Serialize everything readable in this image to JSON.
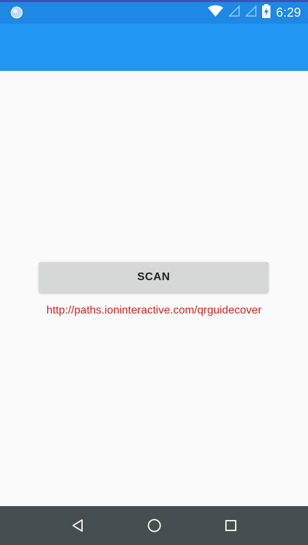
{
  "status_bar": {
    "time": "6:29",
    "background": "#1e88e5",
    "icons": [
      "assistant-bubble-icon",
      "wifi-icon",
      "signal-icon",
      "signal-icon-2",
      "battery-icon"
    ]
  },
  "app_bar": {
    "background": "#2196f3"
  },
  "main": {
    "scan_button_label": "SCAN",
    "result_text": "http://paths.ioninteractive.com/qrguidecover",
    "result_color": "#e01f1f"
  },
  "nav_bar": {
    "buttons": [
      "back-icon",
      "home-icon",
      "recents-icon"
    ],
    "background": "#454f51"
  }
}
